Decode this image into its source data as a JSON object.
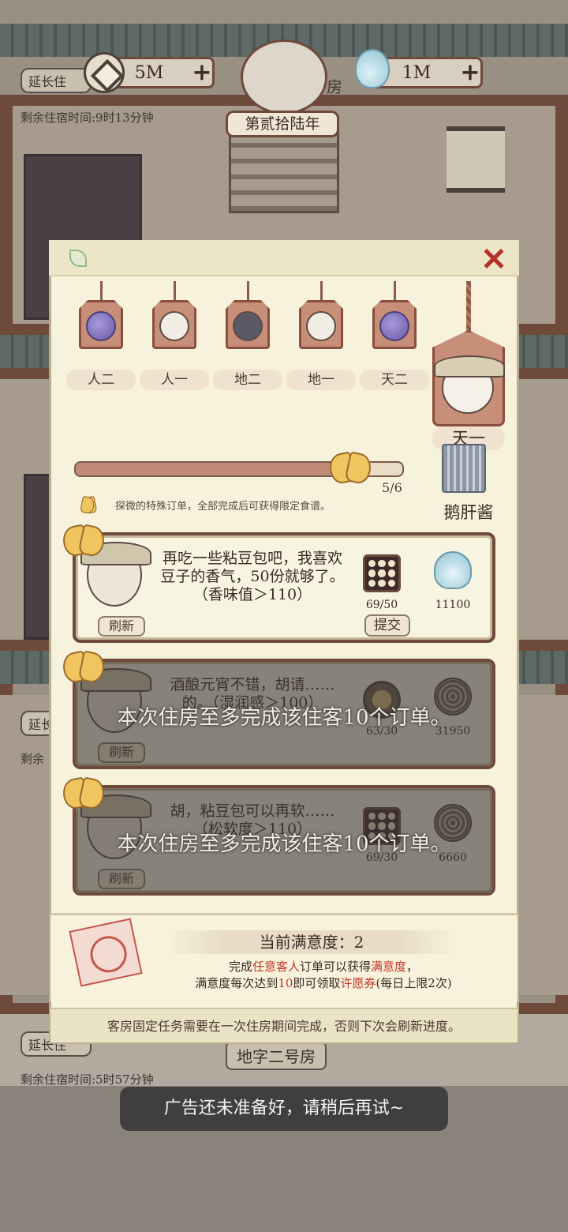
{
  "top_bar": {
    "coins": "5M",
    "spirit": "1M",
    "plus": "+",
    "year": "第贰拾陆年"
  },
  "background": {
    "extend_label": "延长住",
    "room1_time": "剩余住宿时间:9时13分钟",
    "room1_suffix": "房",
    "room2_time": "剩余",
    "room3_time": "剩余住宿时间:5时57分钟",
    "room3_name": "地字二号房"
  },
  "dialog": {
    "close": "✕",
    "tabs": [
      {
        "label": "人二",
        "type": "fruit"
      },
      {
        "label": "人一",
        "type": "face"
      },
      {
        "label": "地二",
        "type": "face"
      },
      {
        "label": "地一",
        "type": "face"
      },
      {
        "label": "天二",
        "type": "fruit"
      }
    ],
    "selected_tab": "天一",
    "progress": {
      "current": 5,
      "total": 6,
      "text": "5/6"
    },
    "recipe_reward": "鹅肝酱",
    "hint": "探微的特殊订单，全部完成后可获得限定食谱。",
    "orders": [
      {
        "text": "再吃一些粘豆包吧，我喜欢豆子的香气，50份就够了。（香味值＞110）",
        "item_count": "69/50",
        "reward_count": "11100",
        "refresh": "刷新",
        "submit": "提交",
        "locked": false
      },
      {
        "text": "酒酿元宵不错，胡请……的。（湿润感＞100）",
        "item_count": "63/30",
        "reward_count": "31950",
        "refresh": "刷新",
        "locked": true,
        "lock_message": "本次住房至多完成该住客10个订单。"
      },
      {
        "text": "胡，粘豆包可以再软……（松软度＞110）",
        "item_count": "69/30",
        "reward_count": "6660",
        "refresh": "刷新",
        "locked": true,
        "lock_message": "本次住房至多完成该住客10个订单。"
      }
    ],
    "satisfaction": {
      "title": "当前满意度：2",
      "line1_pre": "完成",
      "line1_red1": "任意客人",
      "line1_mid": "订单可以获得",
      "line1_red2": "满意度",
      "line1_end": "，",
      "line2_pre": "满意度每次达到",
      "line2_red1": "10",
      "line2_mid": "即可领取",
      "line2_red2": "许愿券",
      "line2_end": "(每日上限2次)"
    },
    "notice": "客房固定任务需要在一次住房期间完成，否则下次会刷新进度。"
  },
  "toast": "广告还未准备好，请稍后再试~"
}
